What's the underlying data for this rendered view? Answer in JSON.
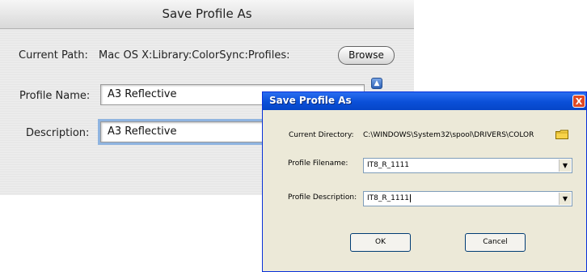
{
  "mac_dialog": {
    "title": "Save Profile As",
    "current_path_label": "Current Path:",
    "current_path_value": "Mac OS X:Library:ColorSync:Profiles:",
    "browse_label": "Browse",
    "profile_name_label": "Profile Name:",
    "profile_name_value": "A3 Reflective",
    "description_label": "Description:",
    "description_value": "A3 Reflective"
  },
  "xp_dialog": {
    "title": "Save Profile As",
    "close_label": "X",
    "current_directory_label": "Current Directory:",
    "current_directory_value": "C:\\WINDOWS\\System32\\spool\\DRIVERS\\COLOR",
    "profile_filename_label": "Profile Filename:",
    "profile_filename_value": "IT8_R_1111",
    "profile_description_label": "Profile Description:",
    "profile_description_value": "IT8_R_1111",
    "ok_label": "OK",
    "cancel_label": "Cancel"
  },
  "icons": {
    "folder": "folder-icon",
    "stepper": "stepper-icon",
    "dropdown": "chevron-down-icon"
  },
  "colors": {
    "xp_title_blue": "#0a4fd8",
    "xp_close_red": "#e04a25",
    "mac_focus_ring": "#8fb4e0"
  }
}
